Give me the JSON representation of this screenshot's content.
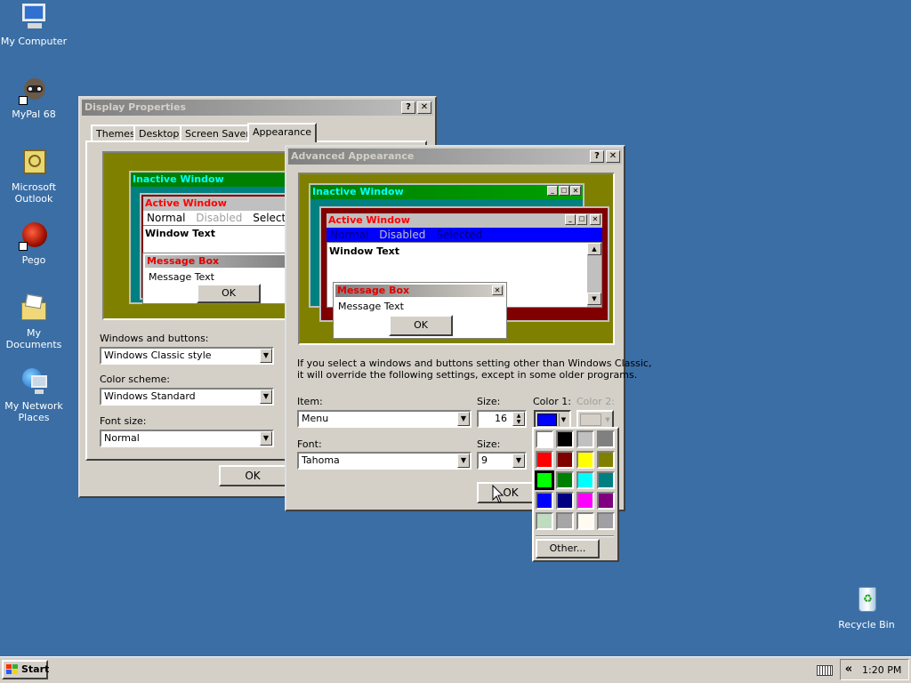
{
  "desktop": {
    "icons": [
      {
        "label": "My Computer"
      },
      {
        "label": "MyPal 68"
      },
      {
        "label": "Microsoft Outlook"
      },
      {
        "label": "Pego"
      },
      {
        "label": "My Documents"
      },
      {
        "label": "My Network Places"
      },
      {
        "label": "Recycle Bin"
      }
    ]
  },
  "display_properties": {
    "title": "Display Properties",
    "tabs": [
      "Themes",
      "Desktop",
      "Screen Saver",
      "Appearance"
    ],
    "preview": {
      "inactive_title": "Inactive Window",
      "active_title": "Active Window",
      "menu_normal": "Normal",
      "menu_disabled": "Disabled",
      "menu_selected": "Selected",
      "window_text": "Window Text",
      "msgbox_title": "Message Box",
      "msgbox_text": "Message Text",
      "ok": "OK"
    },
    "windows_buttons_label": "Windows and buttons:",
    "windows_buttons_value": "Windows Classic style",
    "color_scheme_label": "Color scheme:",
    "color_scheme_value": "Windows Standard",
    "font_size_label": "Font size:",
    "font_size_value": "Normal",
    "ok_button": "OK"
  },
  "advanced": {
    "title": "Advanced Appearance",
    "preview": {
      "inactive_title": "Inactive Window",
      "active_title": "Active Window",
      "menu_normal": "Normal",
      "menu_disabled": "Disabled",
      "menu_selected": "Selected",
      "window_text": "Window Text",
      "msgbox_title": "Message Box",
      "msgbox_text": "Message Text",
      "ok": "OK"
    },
    "info_line1": "If you select a windows and buttons setting other than Windows Classic,",
    "info_line2": "it will override the following settings, except in some older programs.",
    "item_label": "Item:",
    "item_value": "Menu",
    "size_label": "Size:",
    "size_value": "16",
    "color1_label": "Color 1:",
    "color1_value": "#0000ff",
    "color2_label": "Color 2:",
    "font_label": "Font:",
    "font_value": "Tahoma",
    "font_size_label": "Size:",
    "font_size_value": "9",
    "ok_button": "OK"
  },
  "color_picker": {
    "colors": [
      "#ffffff",
      "#000000",
      "#c0c0c0",
      "#808080",
      "#ff0000",
      "#800000",
      "#ffff00",
      "#808000",
      "#00ff00",
      "#008000",
      "#00ffff",
      "#008080",
      "#0000ff",
      "#000080",
      "#ff00ff",
      "#800080",
      "#c0dcc0",
      "#a6a6a6",
      "#fffbf0",
      "#a0a0a4"
    ],
    "selected_index": 8,
    "other_button": "Other..."
  },
  "taskbar": {
    "start_label": "Start",
    "clock": "1:20 PM",
    "chevron": "«"
  }
}
